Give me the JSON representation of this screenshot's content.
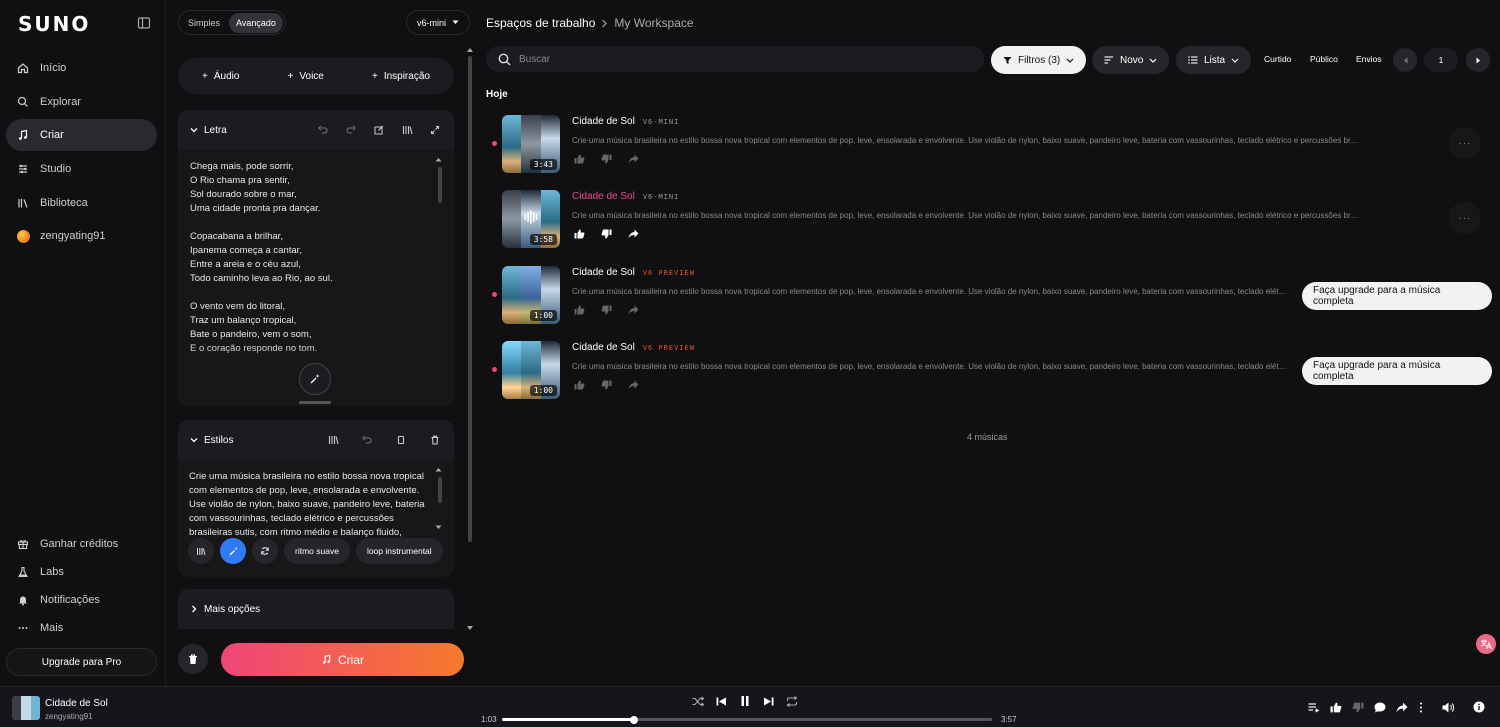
{
  "nav": {
    "logo": "SUNO",
    "items": [
      {
        "label": "Início",
        "icon": "home-icon"
      },
      {
        "label": "Explorar",
        "icon": "search-icon"
      },
      {
        "label": "Criar",
        "icon": "music-note-icon",
        "active": true
      },
      {
        "label": "Studio",
        "icon": "studio-icon"
      },
      {
        "label": "Biblioteca",
        "icon": "library-icon"
      },
      {
        "label": "zengyating91",
        "icon": "avatar"
      }
    ],
    "bottom": [
      {
        "label": "Ganhar créditos",
        "icon": "gift-icon"
      },
      {
        "label": "Labs",
        "icon": "flask-icon"
      },
      {
        "label": "Notificações",
        "icon": "bell-icon"
      },
      {
        "label": "Mais",
        "icon": "more-icon"
      }
    ],
    "upgrade_label": "Upgrade para Pro"
  },
  "create": {
    "mode_simple": "Simples",
    "mode_advanced": "Avançado",
    "model": "v6-mini",
    "add_audio": "Áudio",
    "add_voice": "Voice",
    "add_inspiration": "Inspiração",
    "lyrics_title": "Letra",
    "lyrics": "Chega mais, pode sorrir,\nO Rio chama pra sentir,\nSol dourado sobre o mar,\nUma cidade pronta pra dançar.\n\nCopacabana a brilhar,\nIpanema começa a cantar,\nEntre a areia e o céu azul,\nTodo caminho leva ao Rio, ao sul.\n\nO vento vem do litoral,\nTraz um balanço tropical,\nBate o pandeiro, vem o som,\nE o coração responde no tom.",
    "styles_title": "Estilos",
    "styles_text": "Crie uma música brasileira no estilo bossa nova tropical com elementos de pop, leve, ensolarada e envolvente. Use violão de nylon, baixo suave, pandeiro leve, bateria com vassourinhas, teclado elétrico e percussões brasileiras sutis, com ritmo médio e balanço fluido, vocais calorosos e",
    "chips": [
      "ritmo suave",
      "loop instrumental"
    ],
    "more_options": "Mais opções",
    "create_label": "Criar"
  },
  "workspace": {
    "breadcrumb_root": "Espaços de trabalho",
    "breadcrumb_current": "My Workspace",
    "search_placeholder": "Buscar",
    "filters": "Filtros (3)",
    "sort": "Novo",
    "view": "Lista",
    "liked": "Curtido",
    "public": "Público",
    "uploads": "Envios",
    "page": "1",
    "section": "Hoje",
    "songs": [
      {
        "title": "Cidade de Sol",
        "tag": "V6-MINI",
        "duration": "3:43",
        "desc": "Crie uma música brasileira no estilo bossa nova tropical com elementos de pop, leve, ensolarada e envolvente. Use violão de nylon, baixo suave, pandeiro leve, bateria com vassourinhas, teclado elétrico e percussões brasileira...",
        "more": "···"
      },
      {
        "title": "Cidade de Sol",
        "tag": "V6-MINI",
        "duration": "3:58",
        "desc": "Crie uma música brasileira no estilo bossa nova tropical com elementos de pop, leve, ensolarada e envolvente. Use violão de nylon, baixo suave, pandeiro leve, bateria com vassourinhas, teclado elétrico e percussões brasileira...",
        "more": "···"
      },
      {
        "title": "Cidade de Sol",
        "tag": "V6 PREVIEW",
        "duration": "1:00",
        "desc": "Crie uma música brasileira no estilo bossa nova tropical com elementos de pop, leve, ensolarada e envolvente. Use violão de nylon, baixo suave, pandeiro leve, bateria com vassourinhas, teclado elétrico e p...",
        "upgrade": "Faça upgrade para a música completa"
      },
      {
        "title": "Cidade de Sol",
        "tag": "V6 PREVIEW",
        "duration": "1:00",
        "desc": "Crie uma música brasileira no estilo bossa nova tropical com elementos de pop, leve, ensolarada e envolvente. Use violão de nylon, baixo suave, pandeiro leve, bateria com vassourinhas, teclado elétrico e p...",
        "upgrade": "Faça upgrade para a música completa"
      }
    ],
    "count": "4 músicas"
  },
  "player": {
    "title": "Cidade de Sol",
    "user": "zengyating91",
    "current": "1:03",
    "total": "3:57",
    "progress": 0.27
  },
  "colors": {
    "accent_pink": "#ef4a8c",
    "create_gradient_start": "#f0457a",
    "create_gradient_end": "#f57a2c",
    "preview_tag": "#e8502f",
    "active_blue": "#2f7bf5"
  }
}
